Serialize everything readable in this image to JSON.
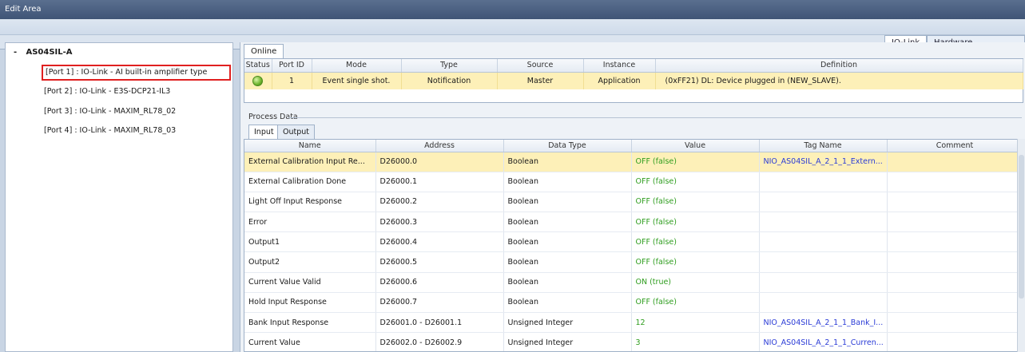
{
  "window": {
    "title": "Edit Area"
  },
  "top_tabs": [
    {
      "label": "IO-Link",
      "active": true
    },
    {
      "label": "Hardware Configuration",
      "active": false
    }
  ],
  "tree": {
    "root": {
      "expander": "-",
      "label": "AS04SIL-A"
    },
    "items": [
      {
        "label": "[Port 1] : IO-Link - AI built-in amplifier type",
        "selected": true
      },
      {
        "label": "[Port 2] : IO-Link - E3S-DCP21-IL3",
        "selected": false
      },
      {
        "label": "[Port 3] : IO-Link - MAXIM_RL78_02",
        "selected": false
      },
      {
        "label": "[Port 4] : IO-Link - MAXIM_RL78_03",
        "selected": false
      }
    ]
  },
  "online": {
    "tab_label": "Online",
    "columns": [
      "Status",
      "Port ID",
      "Mode",
      "Type",
      "Source",
      "Instance",
      "Definition"
    ],
    "rows": [
      {
        "status": "ok",
        "port_id": "1",
        "mode": "Event single shot.",
        "type": "Notification",
        "source": "Master",
        "instance": "Application",
        "definition": "(0xFF21) DL: Device plugged in (NEW_SLAVE)."
      }
    ]
  },
  "process_data": {
    "label": "Process Data",
    "tabs": [
      {
        "label": "Input",
        "active": true
      },
      {
        "label": "Output",
        "active": false
      }
    ],
    "columns": [
      "Name",
      "Address",
      "Data Type",
      "Value",
      "Tag Name",
      "Comment"
    ],
    "rows": [
      {
        "name": "External Calibration Input Re...",
        "address": "D26000.0",
        "data_type": "Boolean",
        "value": "OFF (false)",
        "tag": "NIO_AS04SIL_A_2_1_1_Extern...",
        "comment": ""
      },
      {
        "name": "External Calibration Done",
        "address": "D26000.1",
        "data_type": "Boolean",
        "value": "OFF (false)",
        "tag": "",
        "comment": ""
      },
      {
        "name": "Light Off Input Response",
        "address": "D26000.2",
        "data_type": "Boolean",
        "value": "OFF (false)",
        "tag": "",
        "comment": ""
      },
      {
        "name": "Error",
        "address": "D26000.3",
        "data_type": "Boolean",
        "value": "OFF (false)",
        "tag": "",
        "comment": ""
      },
      {
        "name": "Output1",
        "address": "D26000.4",
        "data_type": "Boolean",
        "value": "OFF (false)",
        "tag": "",
        "comment": ""
      },
      {
        "name": "Output2",
        "address": "D26000.5",
        "data_type": "Boolean",
        "value": "OFF (false)",
        "tag": "",
        "comment": ""
      },
      {
        "name": "Current Value Valid",
        "address": "D26000.6",
        "data_type": "Boolean",
        "value": "ON (true)",
        "tag": "",
        "comment": ""
      },
      {
        "name": "Hold Input Response",
        "address": "D26000.7",
        "data_type": "Boolean",
        "value": "OFF (false)",
        "tag": "",
        "comment": ""
      },
      {
        "name": "Bank Input Response",
        "address": "D26001.0 - D26001.1",
        "data_type": "Unsigned Integer",
        "value": "12",
        "tag": "NIO_AS04SIL_A_2_1_1_Bank_I...",
        "comment": ""
      },
      {
        "name": "Current Value",
        "address": "D26002.0 - D26002.9",
        "data_type": "Unsigned Integer",
        "value": "3",
        "tag": "NIO_AS04SIL_A_2_1_1_Curren...",
        "comment": ""
      }
    ]
  },
  "colors": {
    "highlight": "#fdf0b8",
    "value_green": "#2e9d1e",
    "tag_blue": "#2a3bd6",
    "selection_border": "#e02020"
  }
}
